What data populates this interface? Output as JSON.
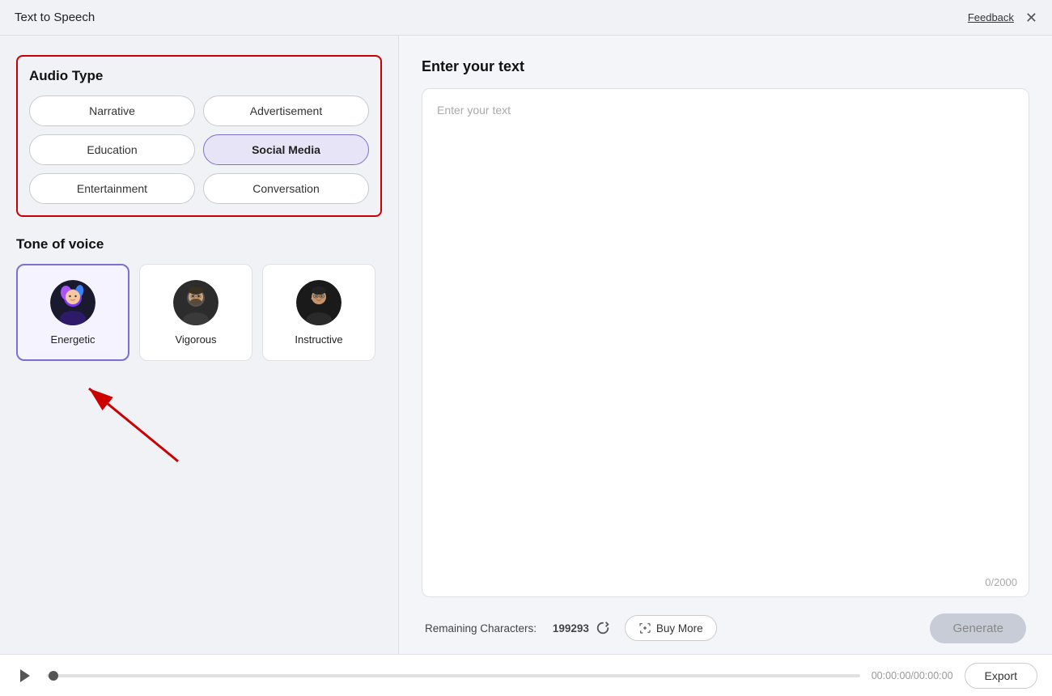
{
  "titleBar": {
    "title": "Text to Speech",
    "feedback": "Feedback",
    "close": "✕"
  },
  "leftPanel": {
    "audioTypeTitle": "Audio Type",
    "audioTypes": [
      {
        "id": "narrative",
        "label": "Narrative",
        "active": false
      },
      {
        "id": "advertisement",
        "label": "Advertisement",
        "active": false
      },
      {
        "id": "education",
        "label": "Education",
        "active": false
      },
      {
        "id": "social-media",
        "label": "Social Media",
        "active": true
      },
      {
        "id": "entertainment",
        "label": "Entertainment",
        "active": false
      },
      {
        "id": "conversation",
        "label": "Conversation",
        "active": false
      }
    ],
    "toneTitle": "Tone of voice",
    "tones": [
      {
        "id": "energetic",
        "label": "Energetic",
        "active": true,
        "colorA": "#a855f7",
        "colorB": "#3b82f6"
      },
      {
        "id": "vigorous",
        "label": "Vigorous",
        "active": false,
        "colorA": "#78716c",
        "colorB": "#44403c"
      },
      {
        "id": "instructive",
        "label": "Instructive",
        "active": false,
        "colorA": "#4b5563",
        "colorB": "#374151"
      }
    ]
  },
  "rightPanel": {
    "title": "Enter your text",
    "placeholder": "Enter your text",
    "charCount": "0/2000",
    "remainingLabel": "Remaining Characters:",
    "remainingValue": "199293",
    "buyMoreLabel": "Buy More",
    "generateLabel": "Generate"
  },
  "footer": {
    "timeDisplay": "00:00:00/00:00:00",
    "exportLabel": "Export"
  }
}
